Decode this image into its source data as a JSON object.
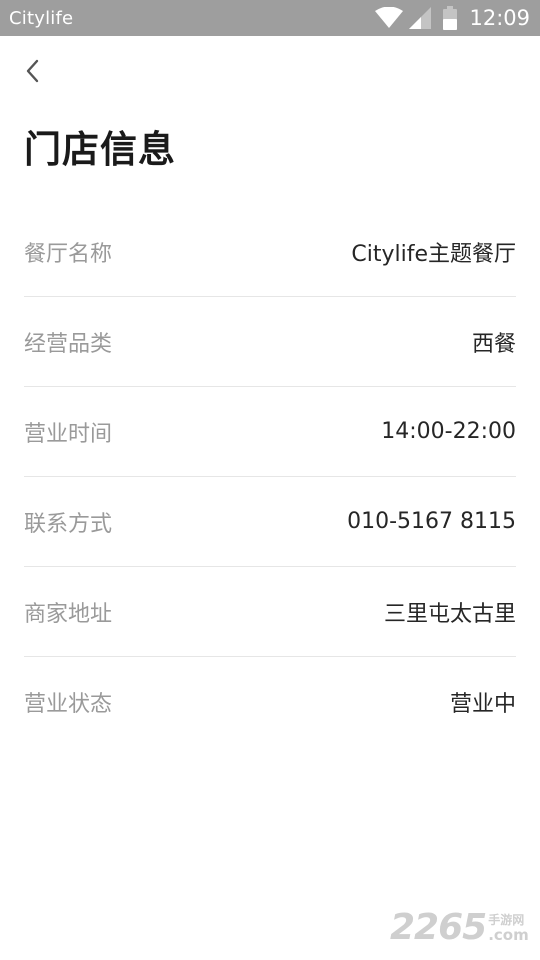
{
  "status_bar": {
    "app_name": "Citylife",
    "time": "12:09",
    "icons": [
      "wifi-icon",
      "signal-icon",
      "battery-icon"
    ]
  },
  "nav": {
    "back_icon": "chevron-left-icon"
  },
  "page": {
    "title": "门店信息"
  },
  "info": {
    "rows": [
      {
        "label": "餐厅名称",
        "value": "Citylife主题餐厅"
      },
      {
        "label": "经营品类",
        "value": "西餐"
      },
      {
        "label": "营业时间",
        "value": "14:00-22:00"
      },
      {
        "label": "联系方式",
        "value": "010-5167 8115"
      },
      {
        "label": "商家地址",
        "value": "三里屯太古里"
      },
      {
        "label": "营业状态",
        "value": "营业中"
      }
    ]
  },
  "watermark": {
    "number": "2265",
    "cn": "手游网",
    "domain": ".com"
  },
  "colors": {
    "status_bar_bg": "#9e9e9e",
    "label": "#9a9a9a",
    "value": "#262626",
    "title": "#1a1a1a",
    "divider": "#e6e6e6"
  }
}
